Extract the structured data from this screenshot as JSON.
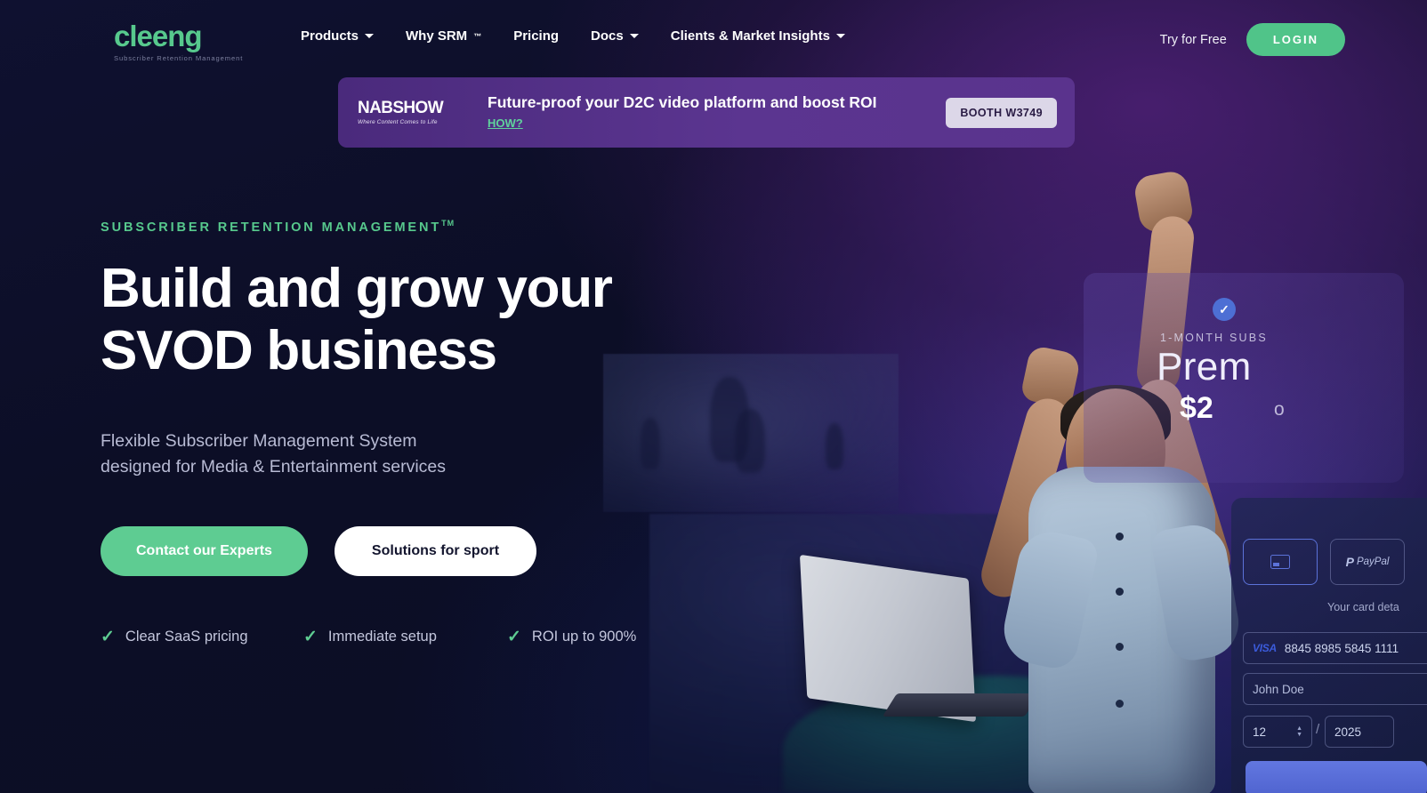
{
  "brand": {
    "logo_word": "cleeng",
    "logo_tagline": "Subscriber Retention Management",
    "accent_green": "#57c98d",
    "banner_purple": "#5b3590"
  },
  "nav": {
    "items": [
      {
        "label": "Products",
        "has_dropdown": true
      },
      {
        "label": "Why SRM",
        "sup": "™",
        "has_dropdown": false
      },
      {
        "label": "Pricing",
        "has_dropdown": false
      },
      {
        "label": "Docs",
        "has_dropdown": true
      },
      {
        "label": "Clients & Market Insights",
        "has_dropdown": true
      }
    ],
    "try_for_free": "Try for Free",
    "login": "LOGIN"
  },
  "banner": {
    "logo_word": "NABSHOW",
    "logo_tagline": "Where Content Comes to Life",
    "headline": "Future-proof your D2C video platform and boost ROI",
    "link_label": "HOW?",
    "booth_badge": "BOOTH W3749"
  },
  "hero": {
    "eyebrow": "SUBSCRIBER RETENTION MANAGEMENT",
    "eyebrow_sup": "TM",
    "title_line_1": "Build and grow your",
    "title_line_2": "SVOD business",
    "subtitle_line_1": "Flexible Subscriber Management System",
    "subtitle_line_2": "designed for Media & Entertainment services",
    "cta_primary": "Contact our Experts",
    "cta_secondary": "Solutions for sport",
    "features": [
      {
        "label": "Clear SaaS pricing"
      },
      {
        "label": "Immediate setup"
      },
      {
        "label": "ROI up to 900%"
      }
    ]
  },
  "premium_card": {
    "subscription_label": "1-MONTH SUBS",
    "plan_name": "Prem",
    "price": "$2",
    "period": "o"
  },
  "checkout": {
    "tab_card": "",
    "tab_paypal_p": "P",
    "tab_paypal_label": "PayPal",
    "card_details_label": "Your card deta",
    "card_brand": "VISA",
    "card_number": "8845 8985 5845 1111",
    "card_name": "John Doe",
    "exp_month": "12",
    "exp_year": "2025",
    "separator": "/"
  }
}
